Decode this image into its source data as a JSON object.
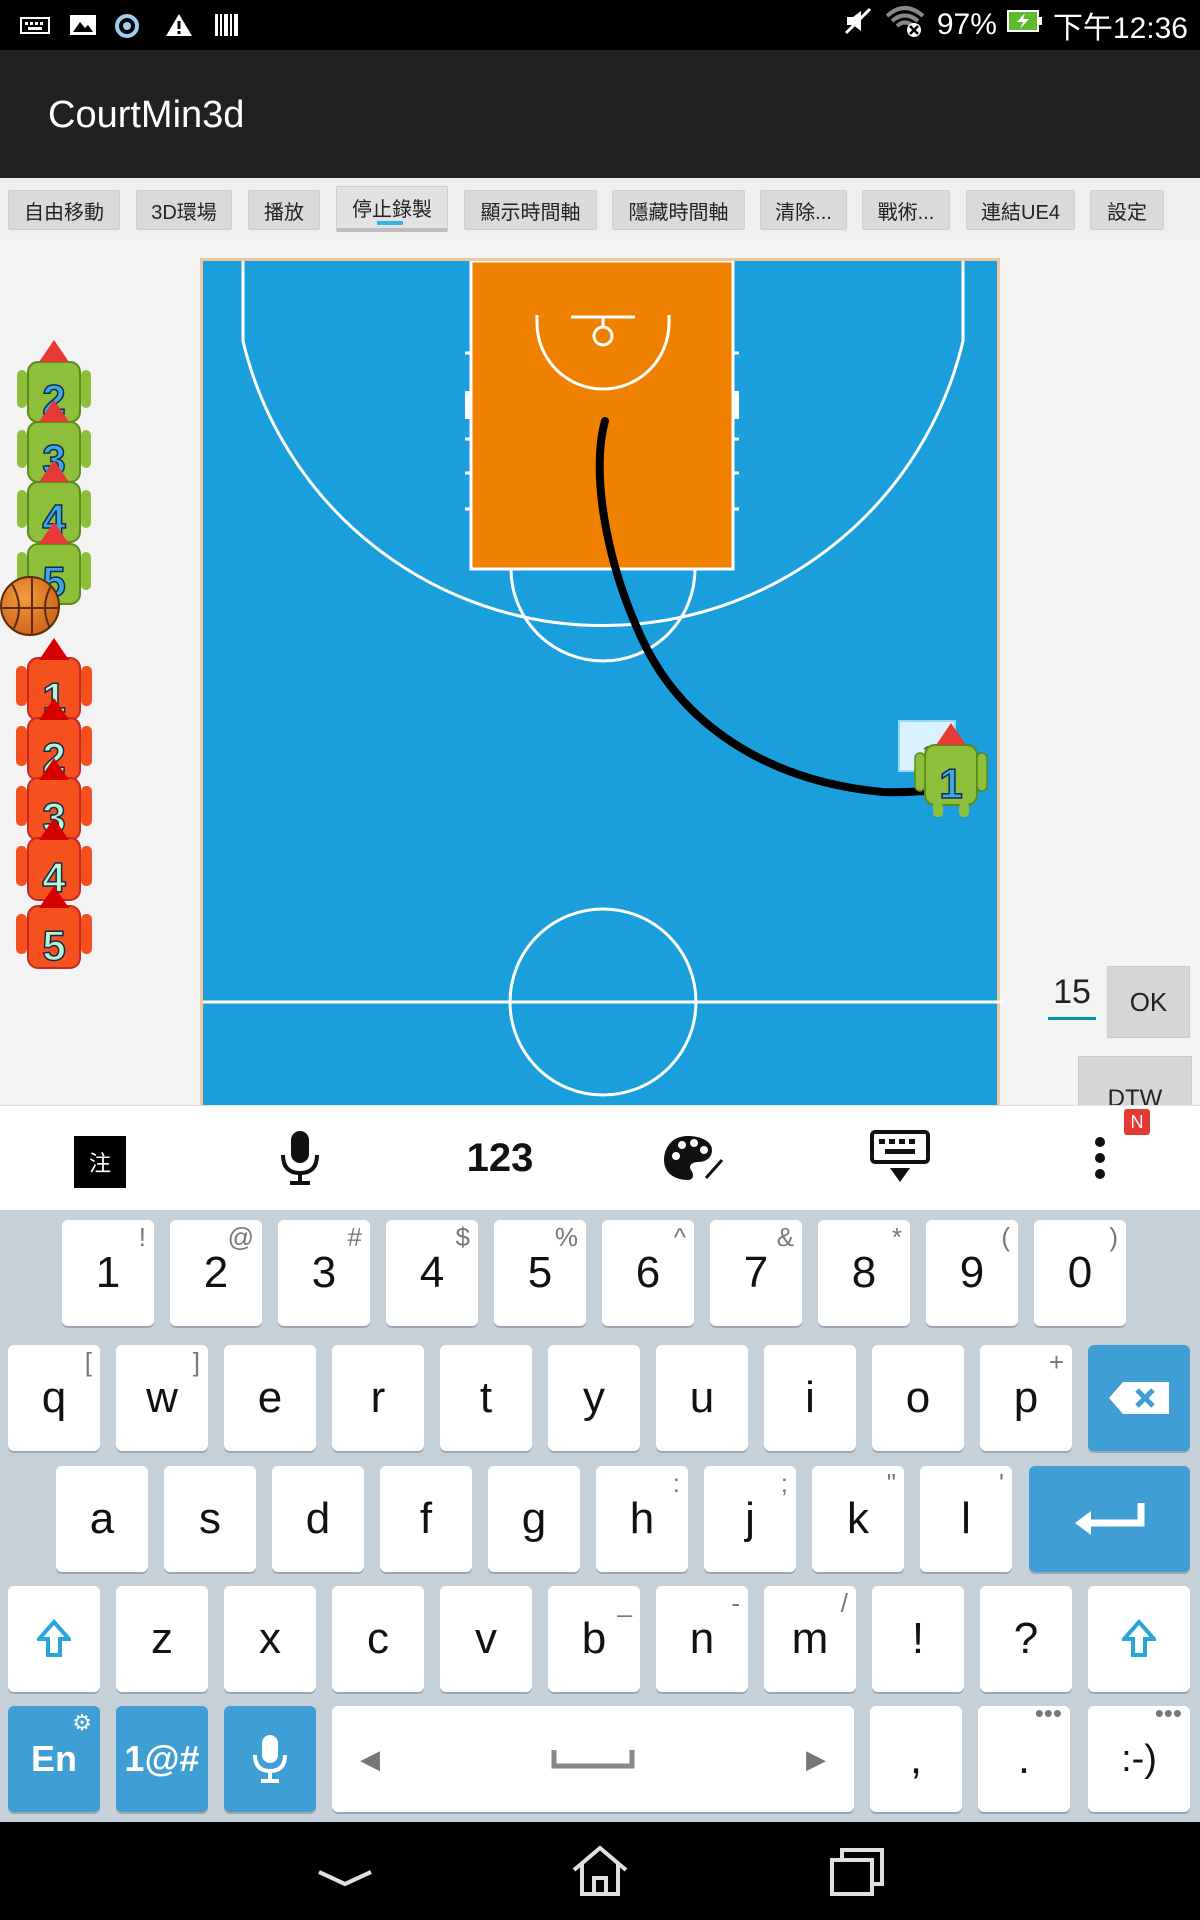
{
  "status_bar": {
    "icons_left": [
      "keyboard-icon",
      "image-icon",
      "app-icon",
      "warning-icon",
      "barcode-icon"
    ],
    "battery_percent": "97%",
    "time": "下午12:36",
    "icons_right": [
      "mute-icon",
      "wifi-off-icon",
      "battery-charging-icon"
    ]
  },
  "app": {
    "title": "CourtMin3d"
  },
  "toolbar": {
    "buttons": [
      {
        "label": "自由移動"
      },
      {
        "label": "3D環場"
      },
      {
        "label": "播放"
      },
      {
        "label": "停止錄製"
      },
      {
        "label": "顯示時間軸"
      },
      {
        "label": "隱藏時間軸"
      },
      {
        "label": "清除..."
      },
      {
        "label": "戰術..."
      },
      {
        "label": "連結UE4"
      },
      {
        "label": "設定"
      }
    ]
  },
  "court": {
    "colors": {
      "floor": "#1a9fdc",
      "paint": "#f08000",
      "lines": "#ffffff",
      "path": "#000000"
    },
    "placed_player": {
      "number": "1",
      "team": "green"
    },
    "placed_player_tag": "1"
  },
  "side_panel": {
    "green_team": [
      "2",
      "3",
      "4",
      "5"
    ],
    "red_team": [
      "1",
      "2",
      "3",
      "4",
      "5"
    ]
  },
  "controls": {
    "number_value": "15",
    "ok_label": "OK",
    "dtw_label": "DTW"
  },
  "keyboard": {
    "toolbar": {
      "zhuyin_label": "注",
      "numbers_label": "123",
      "badge": "N"
    },
    "row1": [
      {
        "k": "1",
        "h": "!"
      },
      {
        "k": "2",
        "h": "@"
      },
      {
        "k": "3",
        "h": "#"
      },
      {
        "k": "4",
        "h": "$"
      },
      {
        "k": "5",
        "h": "%"
      },
      {
        "k": "6",
        "h": "^"
      },
      {
        "k": "7",
        "h": "&"
      },
      {
        "k": "8",
        "h": "*"
      },
      {
        "k": "9",
        "h": "("
      },
      {
        "k": "0",
        "h": ")"
      }
    ],
    "row2": [
      {
        "k": "q",
        "h": "["
      },
      {
        "k": "w",
        "h": "]"
      },
      {
        "k": "e",
        "h": ""
      },
      {
        "k": "r",
        "h": ""
      },
      {
        "k": "t",
        "h": ""
      },
      {
        "k": "y",
        "h": ""
      },
      {
        "k": "u",
        "h": ""
      },
      {
        "k": "i",
        "h": ""
      },
      {
        "k": "o",
        "h": ""
      },
      {
        "k": "p",
        "h": "+"
      }
    ],
    "row3": [
      {
        "k": "a",
        "h": ""
      },
      {
        "k": "s",
        "h": ""
      },
      {
        "k": "d",
        "h": ""
      },
      {
        "k": "f",
        "h": ""
      },
      {
        "k": "g",
        "h": ""
      },
      {
        "k": "h",
        "h": ":"
      },
      {
        "k": "j",
        "h": ";"
      },
      {
        "k": "k",
        "h": "\""
      },
      {
        "k": "l",
        "h": "'"
      }
    ],
    "row4": [
      {
        "k": "z",
        "h": ""
      },
      {
        "k": "x",
        "h": ""
      },
      {
        "k": "c",
        "h": ""
      },
      {
        "k": "v",
        "h": ""
      },
      {
        "k": "b",
        "h": "_"
      },
      {
        "k": "n",
        "h": "-"
      },
      {
        "k": "m",
        "h": "/"
      },
      {
        "k": "!",
        "h": ""
      },
      {
        "k": "?",
        "h": ""
      }
    ],
    "row5": {
      "lang": "En",
      "symbols": "1@#",
      "comma": ",",
      "period": ".",
      "emoticon": ":-)"
    }
  },
  "nav_bar": {
    "icons": [
      "back-icon",
      "home-icon",
      "recents-icon"
    ]
  }
}
